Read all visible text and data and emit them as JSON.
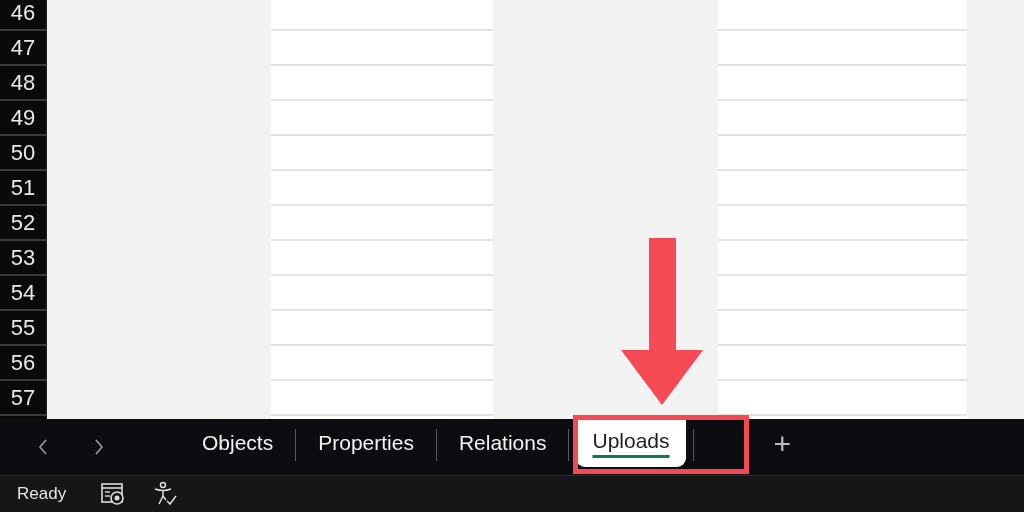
{
  "grid": {
    "rows": [
      "46",
      "47",
      "48",
      "49",
      "50",
      "51",
      "52",
      "53",
      "54",
      "55",
      "56",
      "57"
    ]
  },
  "sheet_tabs": [
    {
      "label": "Objects",
      "selected": false
    },
    {
      "label": "Properties",
      "selected": false
    },
    {
      "label": "Relations",
      "selected": false
    },
    {
      "label": "Uploads",
      "selected": true
    }
  ],
  "add_sheet": "+",
  "status_bar": {
    "text": "Ready"
  }
}
